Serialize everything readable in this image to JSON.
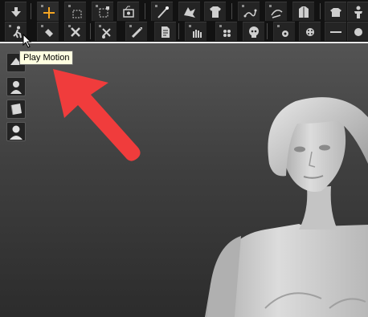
{
  "tooltip": {
    "text": "Play Motion"
  },
  "colors": {
    "toolbar_bg": "#121212",
    "button_bg": "#242424",
    "icon": "#cfcfcf",
    "marker": "#8a8a8a",
    "accent_orange": "#f5a623",
    "annotation_arrow": "#f03c3c",
    "tooltip_bg": "#ffffe1"
  },
  "toolbar": {
    "row1": [
      {
        "name": "down-arrow-icon"
      },
      {
        "name": "move-gizmo-icon",
        "active": true
      },
      {
        "name": "select-box-icon"
      },
      {
        "name": "transform-box-icon"
      },
      {
        "name": "camera-align-icon"
      },
      {
        "name": "wand-icon"
      },
      {
        "name": "dragon-mesh-icon"
      },
      {
        "name": "shirt-icon"
      },
      {
        "name": "link-path-icon"
      },
      {
        "name": "path-edit-icon"
      },
      {
        "name": "jacket-icon"
      },
      {
        "name": "bone-icon"
      },
      {
        "name": "body-icon"
      }
    ],
    "row2": [
      {
        "name": "play-motion-icon"
      },
      {
        "name": "walk-bone-icon"
      },
      {
        "name": "pose-knot-icon"
      },
      {
        "name": "scissors-icon"
      },
      {
        "name": "brush-icon"
      },
      {
        "name": "doc-icon"
      },
      {
        "name": "hand-icon"
      },
      {
        "name": "morph-icon"
      },
      {
        "name": "skull-icon"
      },
      {
        "name": "target-icon"
      },
      {
        "name": "dots-icon"
      },
      {
        "name": "bar-icon"
      },
      {
        "name": "circle-icon"
      }
    ]
  },
  "side_buttons": [
    {
      "name": "scene-tab-icon"
    },
    {
      "name": "person-tab-icon"
    },
    {
      "name": "material-tab-icon"
    },
    {
      "name": "avatar-tab-icon"
    }
  ]
}
